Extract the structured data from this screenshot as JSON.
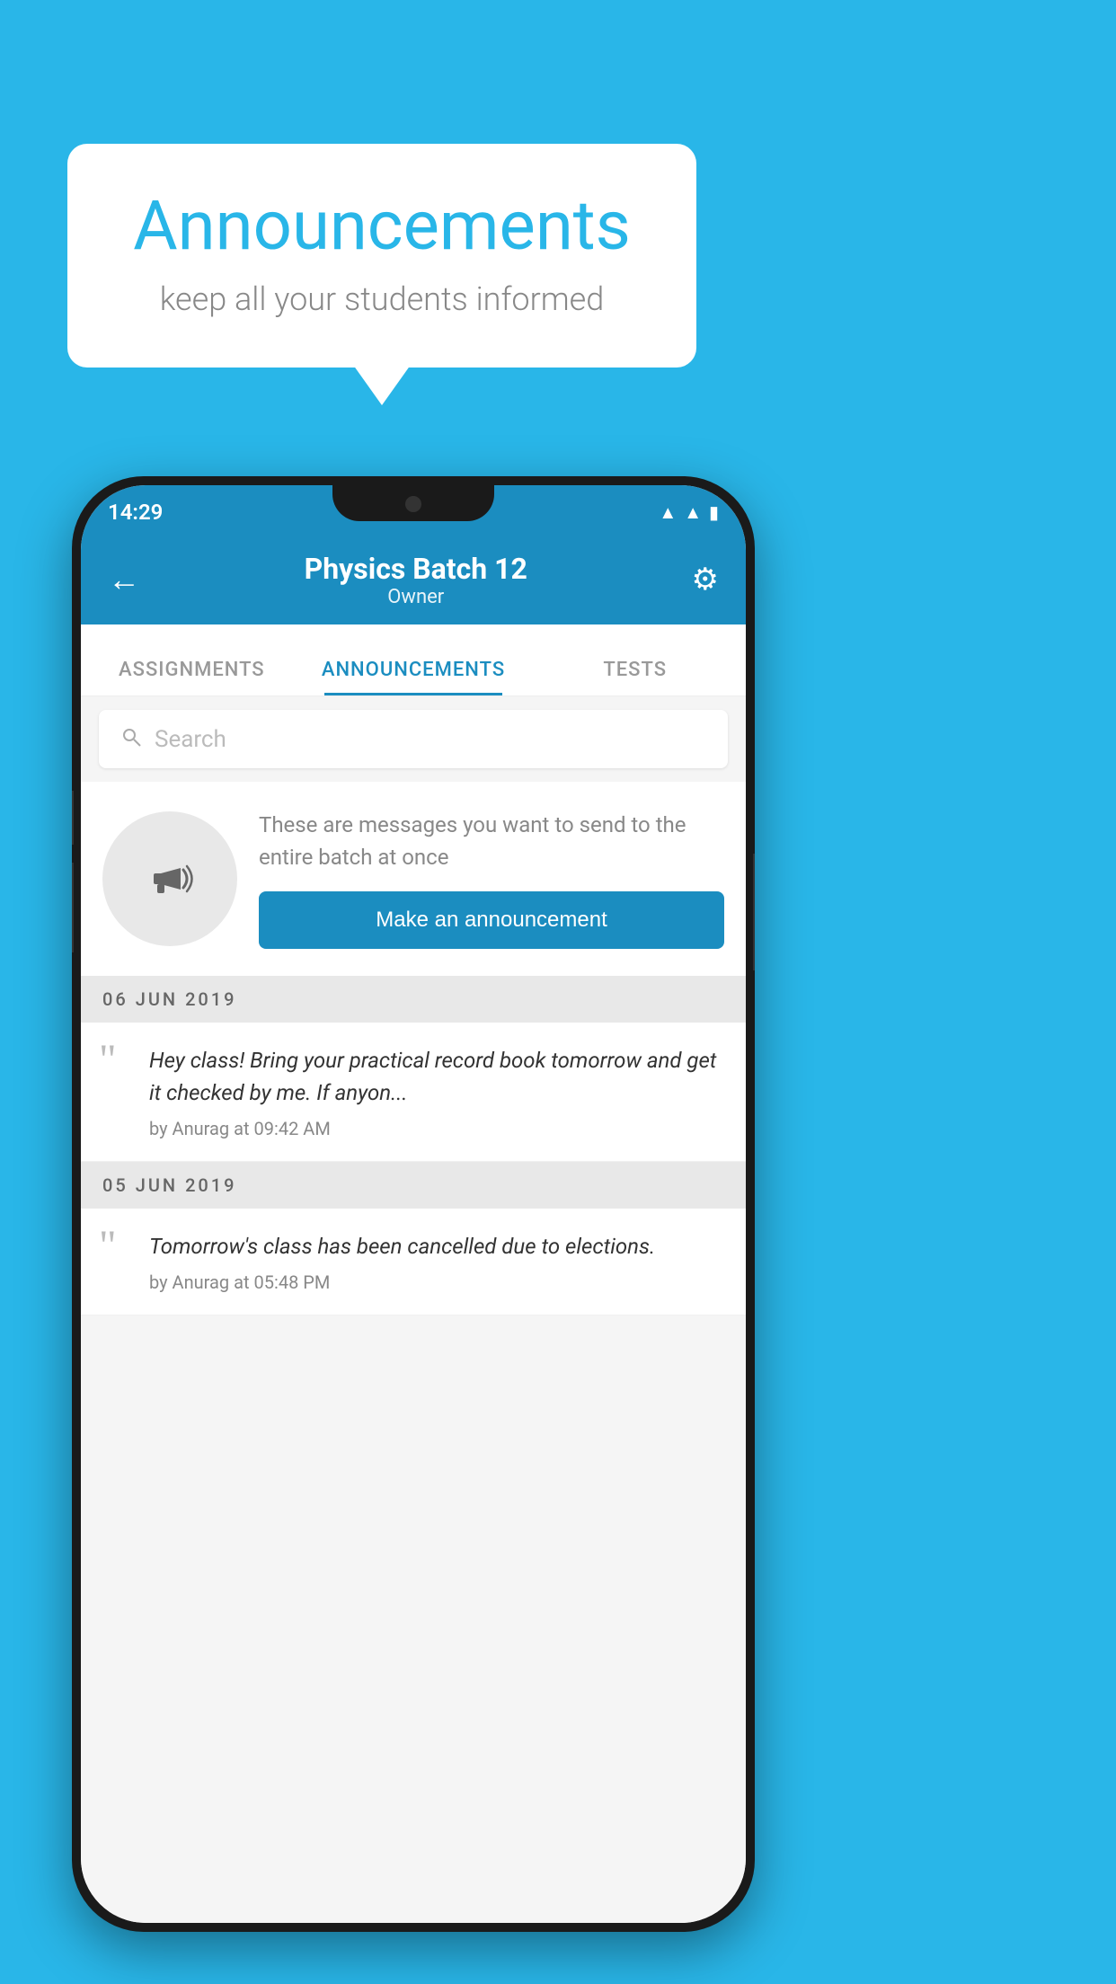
{
  "page": {
    "background_color": "#29B6E8"
  },
  "speech_bubble": {
    "title": "Announcements",
    "subtitle": "keep all your students informed"
  },
  "phone": {
    "status_bar": {
      "time": "14:29"
    },
    "app_bar": {
      "back_label": "←",
      "title": "Physics Batch 12",
      "subtitle": "Owner",
      "settings_label": "⚙"
    },
    "tabs": [
      {
        "label": "ASSIGNMENTS",
        "active": false
      },
      {
        "label": "ANNOUNCEMENTS",
        "active": true
      },
      {
        "label": "TESTS",
        "active": false
      }
    ],
    "search": {
      "placeholder": "Search"
    },
    "promo": {
      "description": "These are messages you want to send to the entire batch at once",
      "button_label": "Make an announcement"
    },
    "announcements": [
      {
        "date": "06  JUN  2019",
        "message": "Hey class! Bring your practical record book tomorrow and get it checked by me. If anyon...",
        "meta": "by Anurag at 09:42 AM"
      },
      {
        "date": "05  JUN  2019",
        "message": "Tomorrow's class has been cancelled due to elections.",
        "meta": "by Anurag at 05:48 PM"
      }
    ]
  }
}
